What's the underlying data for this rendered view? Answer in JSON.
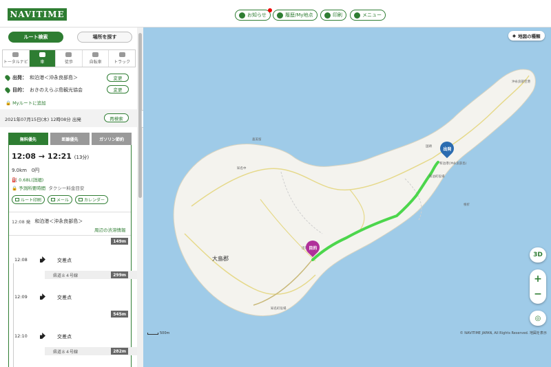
{
  "header": {
    "logo": "NAVITIME",
    "buttons": [
      {
        "label": "お知らせ",
        "icon": "megaphone-icon"
      },
      {
        "label": "履歴/My地点",
        "icon": "star-icon"
      },
      {
        "label": "印刷",
        "icon": "print-icon"
      },
      {
        "label": "メニュー",
        "icon": "user-icon"
      }
    ]
  },
  "sidebar": {
    "top_tabs": [
      "ルート検索",
      "場所を探す"
    ],
    "modes": [
      "トータルナビ",
      "車",
      "徒歩",
      "自転車",
      "トラック"
    ],
    "origin_label": "出発：",
    "origin_value": "和泊港＜沖永良部島＞",
    "dest_label": "目的：",
    "dest_value": "おきのえらぶ島観光協会",
    "change_label": "変更",
    "my_route": "Myルートに追加",
    "datetime": "2021年07月15日(木) 12時08分 出発",
    "research": "再検索",
    "route_tabs": [
      "無料優先",
      "距離優先",
      "ガソリン節約"
    ],
    "depart_time": "12:08",
    "arrow": "→",
    "arrive_time": "12:21",
    "duration": "(13分)",
    "distance": "9.0km",
    "price": "0円",
    "fuel": "0.68L(詳細)",
    "toll_link": "予測所要時間",
    "taxi": "タクシー料金目安",
    "actions": [
      "ルート印刷",
      "メール",
      "カレンダー"
    ],
    "start_time": "12:08 発",
    "start_name": "和泊港＜沖永良部島＞",
    "nearby": "周辺の渋滞情報",
    "first_dist": "149m",
    "steps": [
      {
        "time": "12:08",
        "name": "交差点",
        "road": "県道８４号線",
        "dist": "299m"
      },
      {
        "time": "12:09",
        "name": "交差点",
        "road": "",
        "dist": "545m"
      },
      {
        "time": "12:10",
        "name": "交差点",
        "road": "県道８４号線",
        "dist": "282m"
      }
    ]
  },
  "map": {
    "type_button": "地図の種類",
    "btn_3d": "3D",
    "zoom_in": "+",
    "zoom_out": "−",
    "start_pin": "出発",
    "goal_pin": "目的",
    "district": "大島郡",
    "scale": "500m",
    "copyright": "© NAVITIME JAPAN, All Rights Reserved. 地図を表示",
    "labels": [
      "和泊港(沖永良部島)",
      "和泊町役場",
      "知名町役場",
      "沖永良部空港",
      "喜美留",
      "国頭",
      "知名中",
      "根折",
      "出花"
    ],
    "colors": {
      "brand": "#2e7d32",
      "route": "#4cd64c",
      "start_pin": "#2b6cb0",
      "goal_pin": "#b0309a",
      "sea": "#9fcbe8",
      "land": "#f4f3ee"
    }
  }
}
